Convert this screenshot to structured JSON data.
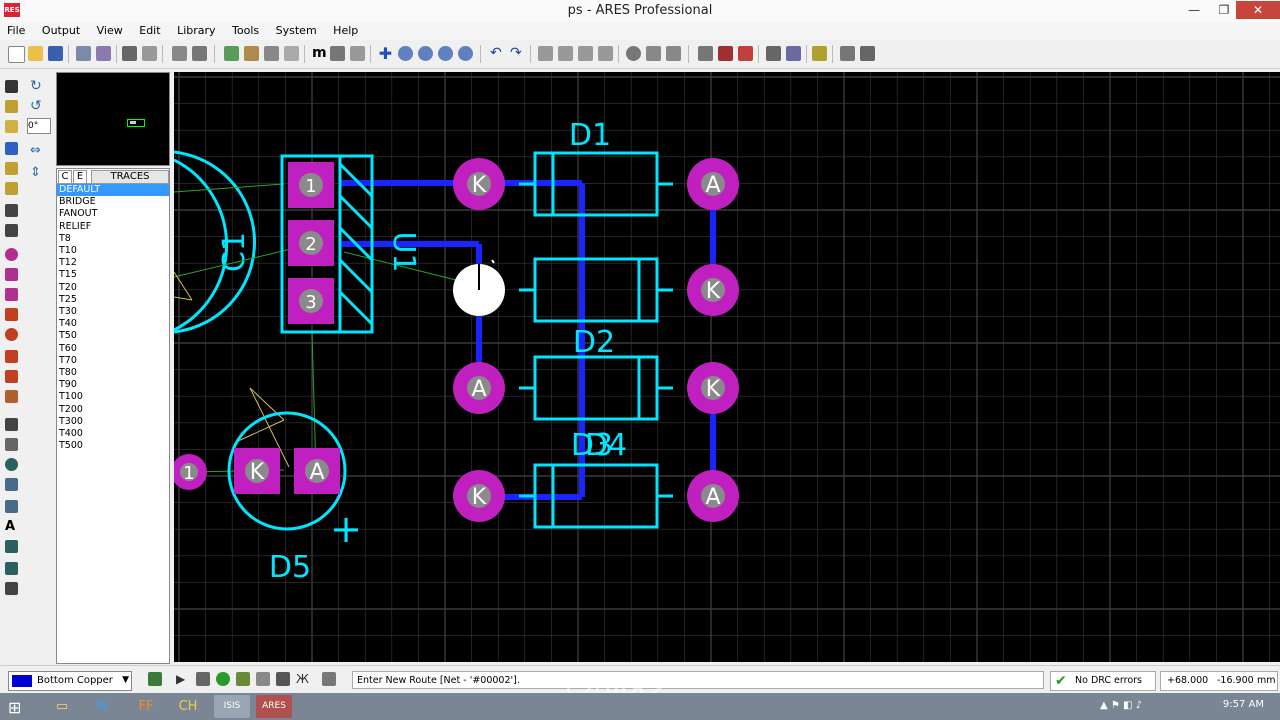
{
  "window": {
    "title": "ps - ARES Professional",
    "app_icon": "RES",
    "min": "—",
    "max": "❐",
    "close": "✕"
  },
  "menu": [
    "File",
    "Output",
    "View",
    "Edit",
    "Library",
    "Tools",
    "System",
    "Help"
  ],
  "left_tools": {
    "rotate_angle": "0°"
  },
  "panel": {
    "tab_c": "C",
    "tab_e": "E",
    "tab_title": "TRACES",
    "items": [
      "DEFAULT",
      "BRIDGE",
      "FANOUT",
      "RELIEF",
      "T8",
      "T10",
      "T12",
      "T15",
      "T20",
      "T25",
      "T30",
      "T40",
      "T50",
      "T60",
      "T70",
      "T80",
      "T90",
      "T100",
      "T200",
      "T300",
      "T400",
      "T500"
    ],
    "selected": "DEFAULT"
  },
  "pcb": {
    "colors": {
      "pad": "#c020c0",
      "silk": "#00e6ff",
      "trace": "#1a24ff",
      "ratsnest": "#2aa52a",
      "highlight": "#d4c04a",
      "grid": "#3a3a3a"
    },
    "labels": {
      "c1": "C1",
      "u1": "U1",
      "d1": "D1",
      "d2": "D2",
      "d3": "D3",
      "d4": "D4",
      "d5": "D5",
      "plus": "+"
    },
    "u1_pads": [
      "1",
      "2",
      "3"
    ],
    "d1_pads": [
      "K",
      "A"
    ],
    "d2_pads": [
      "K"
    ],
    "d3_pads": [
      "A",
      "K"
    ],
    "d4_pads": [
      "K",
      "A"
    ],
    "d5_pads": [
      "K",
      "A"
    ],
    "edge_pad": "1"
  },
  "status": {
    "layer": "Bottom Copper",
    "message": "Enter New Route [Net - '#00002'].",
    "drc": "No DRC errors",
    "x": "+68.000",
    "y": "-16.900",
    "unit": "mm"
  },
  "taskbar": {
    "time": "9:57 AM",
    "tasks": [
      "IE",
      "FF",
      "CH",
      "ISIS",
      "ARES"
    ],
    "tray": "▲ ⚑ ◧ ♪"
  },
  "watermark": "خمسات"
}
